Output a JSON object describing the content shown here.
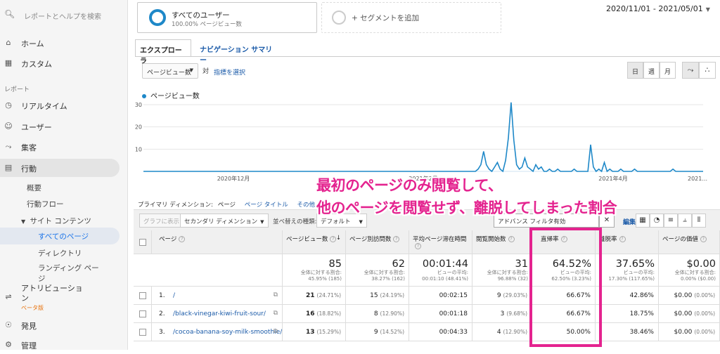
{
  "sidebar": {
    "search_placeholder": "レポートとヘルプを検索",
    "home": "ホーム",
    "custom": "カスタム",
    "reports_section": "レポート",
    "realtime": "リアルタイム",
    "users": "ユーザー",
    "acquisition": "集客",
    "behavior": "行動",
    "overview": "概要",
    "behavior_flow": "行動フロー",
    "site_content": "サイト コンテンツ",
    "all_pages": "すべてのページ",
    "directory": "ディレクトリ",
    "landing_pages_1": "ランディング ペー",
    "landing_pages_2": "ジ",
    "attribution_1": "アトリビューショ",
    "attribution_2": "ン",
    "beta": "ベータ版",
    "discover": "発見",
    "admin": "管理"
  },
  "segments": {
    "seg1_title": "すべてのユーザー",
    "seg1_sub": "100.00% ページビュー数",
    "seg2_title": "+ セグメントを追加"
  },
  "date_range": "2020/11/01 - 2021/05/01",
  "tabs": {
    "explorer": "エクスプローラ",
    "nav_summary": "ナビゲーション サマリー"
  },
  "chart_controls": {
    "metric": "ページビュー数",
    "vs": "対",
    "choose_metric": "指標を選択",
    "day": "日",
    "week": "週",
    "month": "月"
  },
  "chart_data": {
    "type": "line",
    "series": [
      {
        "name": "ページビュー数"
      }
    ],
    "y_ticks": [
      10,
      20,
      30
    ],
    "x_labels": [
      "2020年12月",
      "2021年2月",
      "2021年4月",
      "2021..."
    ],
    "color": "#1e88c8",
    "values": [
      0,
      0,
      0,
      0,
      0,
      0,
      0,
      0,
      0,
      0,
      0,
      0,
      0,
      0,
      0,
      0,
      0,
      0,
      0,
      0,
      0,
      0,
      0,
      0,
      0,
      0,
      0,
      0,
      0,
      0,
      0,
      0,
      0,
      0,
      0,
      0,
      0,
      0,
      0,
      0,
      0,
      0,
      0,
      0,
      0,
      0,
      0,
      0,
      0,
      0,
      0,
      0,
      0,
      0,
      0,
      0,
      0,
      0,
      0,
      0,
      0,
      0,
      0,
      0,
      0,
      0,
      0,
      0,
      0,
      0,
      0,
      0,
      0,
      0,
      0,
      0,
      0,
      0,
      0,
      0,
      0,
      0,
      0,
      0,
      0,
      0,
      0,
      0,
      0,
      0,
      0,
      0,
      0,
      0,
      0,
      0,
      0,
      0,
      0,
      0,
      0,
      0,
      0,
      0,
      0,
      0,
      0,
      0,
      0,
      0,
      0,
      0,
      0,
      0,
      0,
      0,
      0,
      0,
      0,
      0,
      0,
      0,
      1,
      3,
      9,
      3,
      1,
      0,
      2,
      4,
      1,
      0,
      5,
      15,
      31,
      14,
      3,
      1,
      2,
      6,
      2,
      1,
      0,
      3,
      1,
      2,
      0,
      0,
      1,
      0,
      0,
      1,
      0,
      0,
      0,
      0,
      0,
      1,
      0,
      0,
      0,
      0,
      0,
      12,
      2,
      0,
      1,
      0,
      4,
      0,
      1,
      0,
      0,
      0,
      1,
      0,
      0,
      0,
      0,
      1,
      0,
      0,
      0,
      0,
      0,
      0,
      0,
      0,
      0,
      0,
      0,
      0,
      0,
      1,
      0,
      0,
      0,
      0,
      0,
      0,
      0,
      0,
      0,
      0,
      0
    ]
  },
  "overlay": {
    "line1": "最初のページのみ閲覧して、",
    "line2": "他のページを閲覧せず、離脱してしまった割合"
  },
  "primary_dim": {
    "label": "プライマリ ディメンション:",
    "current": "ページ",
    "page_title": "ページ タイトル",
    "other": "その他"
  },
  "controls": {
    "graph_display": "グラフに表示",
    "secondary_dim": "セカンダリ ディメンション",
    "sort_type": "並べ替えの種類:",
    "default": "デフォルト",
    "filter": "アドバンス フィルタ有効",
    "edit": "編集"
  },
  "headers": {
    "page": "ページ",
    "pageviews": "ページビュー数",
    "unique": "ページ別訪問数",
    "avg_time": "平均ページ滞在時間",
    "entrances": "閲覧開始数",
    "bounce": "直帰率",
    "exit": "離脱率",
    "value": "ページの価値"
  },
  "summary": {
    "pageviews": {
      "big": "85",
      "s1": "全体に対する割合:",
      "s2": "45.95% (185)"
    },
    "unique": {
      "big": "62",
      "s1": "全体に対する割合:",
      "s2": "38.27% (162)"
    },
    "avg_time": {
      "big": "00:01:44",
      "s1": "ビューの平均:",
      "s2": "00:01:10 (48.41%)"
    },
    "entrances": {
      "big": "31",
      "s1": "全体に対する割合:",
      "s2": "96.88% (32)"
    },
    "bounce": {
      "big": "64.52%",
      "s1": "ビューの平均:",
      "s2": "62.50% (3.23%)"
    },
    "exit": {
      "big": "37.65%",
      "s1": "ビューの平均:",
      "s2": "17.30% (117.65%)"
    },
    "value": {
      "big": "$0.00",
      "s1": "全体に対する割合:",
      "s2": "0.00% ($0.00)"
    }
  },
  "rows": [
    {
      "num": "1.",
      "page": "/",
      "pv": "21",
      "pv_pct": "(24.71%)",
      "un": "15",
      "un_pct": "(24.19%)",
      "time": "00:02:15",
      "ent": "9",
      "ent_pct": "(29.03%)",
      "bounce": "66.67%",
      "exit": "42.86%",
      "val": "$0.00",
      "val_pct": "(0.00%)"
    },
    {
      "num": "2.",
      "page": "/black-vinegar-kiwi-fruit-sour/",
      "pv": "16",
      "pv_pct": "(18.82%)",
      "un": "8",
      "un_pct": "(12.90%)",
      "time": "00:01:18",
      "ent": "3",
      "ent_pct": "(9.68%)",
      "bounce": "66.67%",
      "exit": "18.75%",
      "val": "$0.00",
      "val_pct": "(0.00%)"
    },
    {
      "num": "3.",
      "page": "/cocoa-banana-soy-milk-smoothie/",
      "pv": "13",
      "pv_pct": "(15.29%)",
      "un": "9",
      "un_pct": "(14.52%)",
      "time": "00:04:33",
      "ent": "4",
      "ent_pct": "(12.90%)",
      "bounce": "50.00%",
      "exit": "38.46%",
      "val": "$0.00",
      "val_pct": "(0.00%)"
    }
  ]
}
